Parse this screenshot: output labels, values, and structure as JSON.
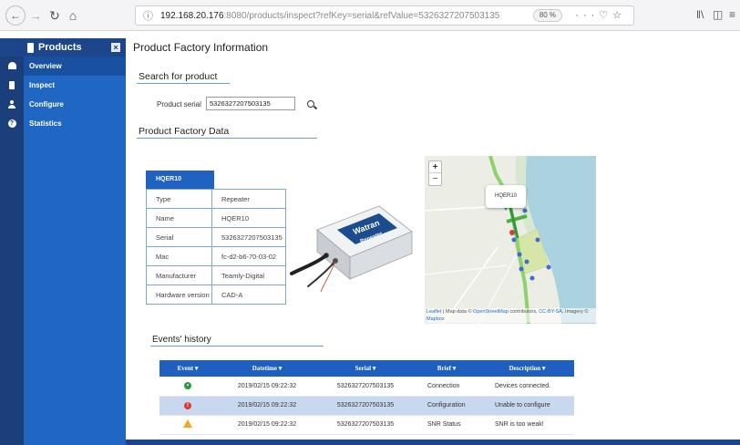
{
  "browser": {
    "url_host": "192.168.20.176",
    "url_rest": ":8080/products/inspect?refKey=serial&refValue=5326327207503135",
    "zoom": "80 %"
  },
  "sidebar": {
    "title": "Products",
    "items": [
      {
        "label": "Overview",
        "icon": "home-icon",
        "active": true
      },
      {
        "label": "Inspect",
        "icon": "inspect-icon",
        "active": false
      },
      {
        "label": "Configure",
        "icon": "user-icon",
        "active": false
      },
      {
        "label": "Statistics",
        "icon": "question-icon",
        "active": false
      }
    ]
  },
  "main": {
    "title": "Product Factory Information",
    "search_section": "Search for product",
    "serial_label": "Product serial",
    "serial_value": "5326327207503135",
    "data_section": "Product Factory Data"
  },
  "product": {
    "tab_label": "HQER10",
    "rows": [
      {
        "key": "Type",
        "value": "Repeater"
      },
      {
        "key": "Name",
        "value": "HQER10"
      },
      {
        "key": "Serial",
        "value": "5326327207503135"
      },
      {
        "key": "Mac",
        "value": "fc-d2-b6-70-03-02"
      },
      {
        "key": "Manufacturer",
        "value": "Teamly-Digital"
      },
      {
        "key": "Hardware version",
        "value": "CAD-A"
      }
    ],
    "device_brand": "Watran",
    "device_model": "Repeater"
  },
  "map": {
    "popup_label": "HQER10",
    "attribution_prefix": "Leaflet",
    "attribution_text": " | Map data © ",
    "osm": "OpenStreetMap",
    "contributors": " contributors, ",
    "license": "CC-BY-SA",
    "imagery": ", Imagery ©",
    "mapbox": "Mapbox",
    "zoom_in": "+",
    "zoom_out": "−"
  },
  "events": {
    "title": "Events' history",
    "headers": [
      "Event",
      "Datetime",
      "Serial",
      "Brief",
      "Description"
    ],
    "rows": [
      {
        "status": "ok",
        "datetime": "2019/02/15 09:22:32",
        "serial": "5326327207503135",
        "brief": "Connection",
        "description": "Devices connected."
      },
      {
        "status": "err",
        "datetime": "2019/02/15 09:22:32",
        "serial": "5326327207503135",
        "brief": "Configuration",
        "description": "Unable to configure"
      },
      {
        "status": "warn",
        "datetime": "2019/02/15 09:22:32",
        "serial": "5326327207503135",
        "brief": "SNR Status",
        "description": "SNR is too weak!"
      }
    ]
  },
  "colors": {
    "sidebar_dark": "#1a3f7b",
    "sidebar_nav": "#2067c4",
    "table_header": "#1f5fbf",
    "selected_row": "#c8d8ef",
    "ok": "#2e9a3b",
    "error": "#dd3b30",
    "warning": "#f2a81d"
  }
}
